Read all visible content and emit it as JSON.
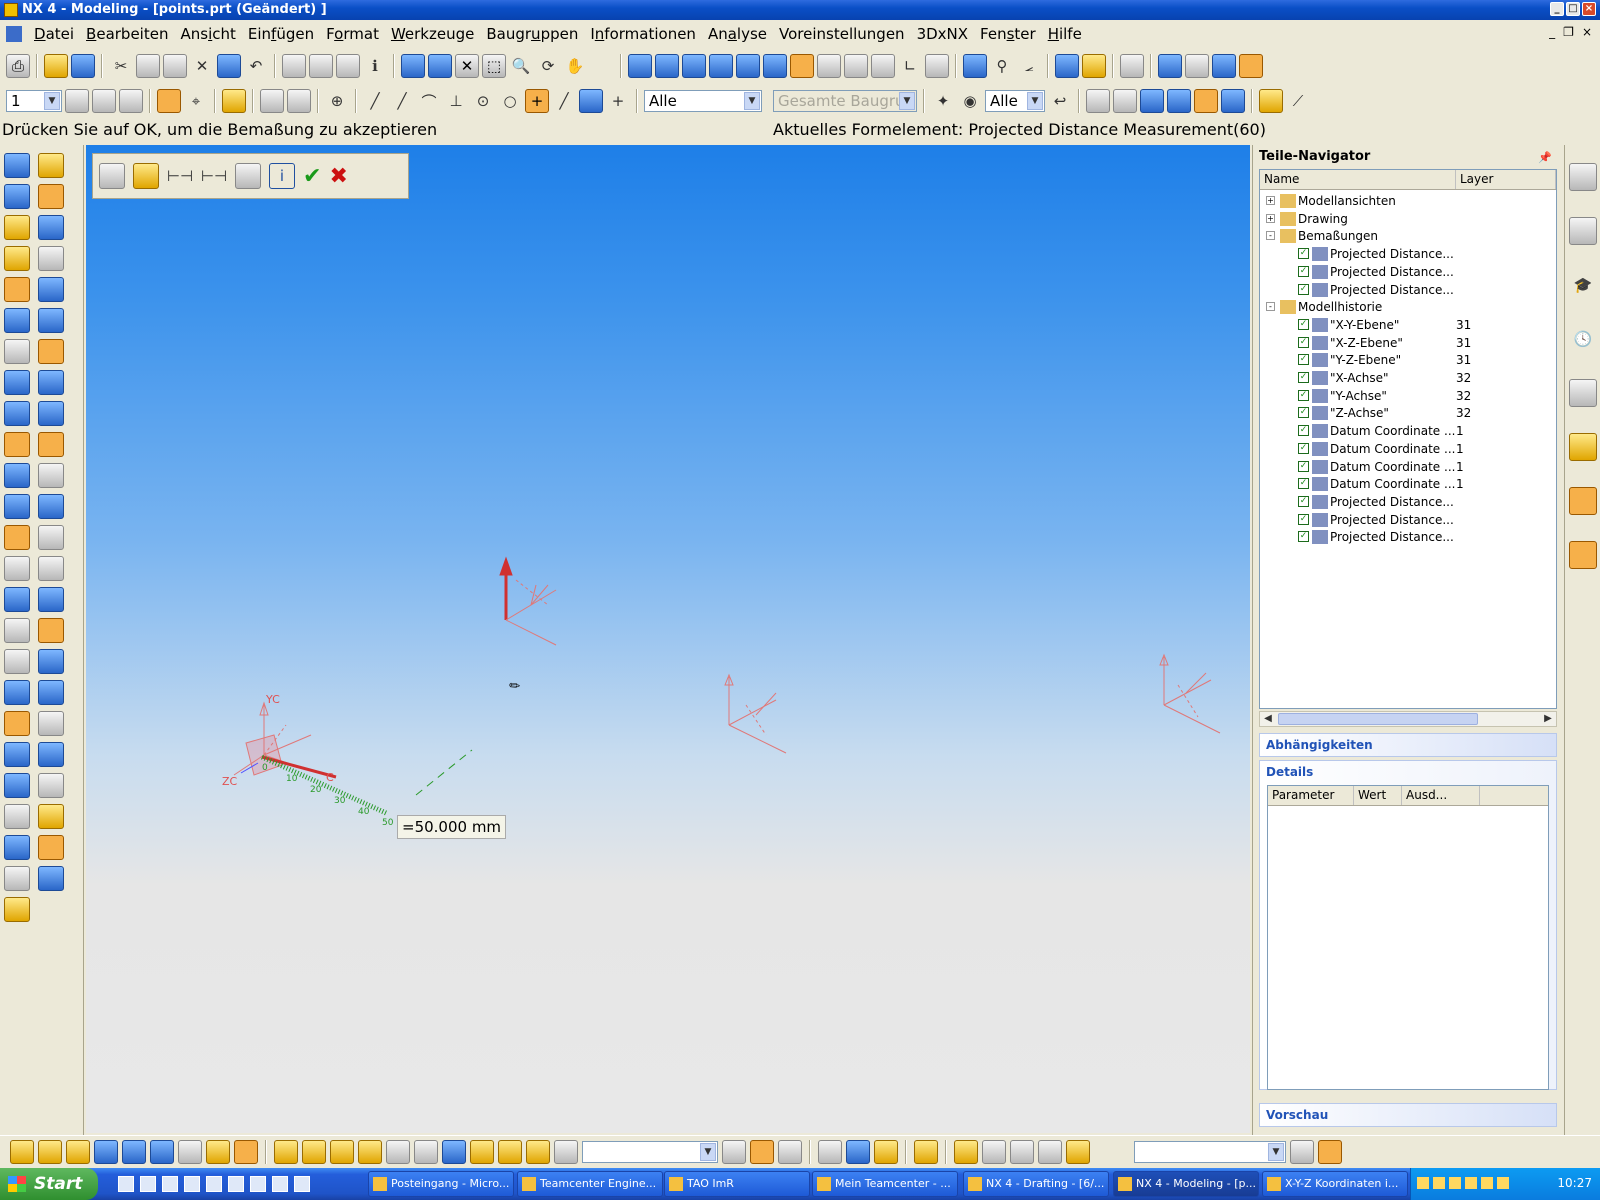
{
  "window": {
    "title": "NX 4 - Modeling - [points.prt (Geändert) ]"
  },
  "menu": [
    {
      "pre": "",
      "u": "D",
      "post": "atei"
    },
    {
      "pre": "",
      "u": "B",
      "post": "earbeiten"
    },
    {
      "pre": "Ans",
      "u": "i",
      "post": "cht"
    },
    {
      "pre": "Ein",
      "u": "f",
      "post": "ügen"
    },
    {
      "pre": "F",
      "u": "o",
      "post": "rmat"
    },
    {
      "pre": "",
      "u": "W",
      "post": "erkzeuge"
    },
    {
      "pre": "Baugr",
      "u": "u",
      "post": "ppen"
    },
    {
      "pre": "I",
      "u": "n",
      "post": "formationen"
    },
    {
      "pre": "An",
      "u": "a",
      "post": "lyse"
    },
    {
      "pre": "Voreinstellungen",
      "u": "",
      "post": ""
    },
    {
      "pre": "3DxNX",
      "u": "",
      "post": ""
    },
    {
      "pre": "Fen",
      "u": "s",
      "post": "ter"
    },
    {
      "pre": "",
      "u": "H",
      "post": "ilfe"
    }
  ],
  "toolbar2": {
    "layer_value": "1",
    "filter1": "Alle",
    "filter2": "Gesamte Baugru",
    "filter3": "Alle"
  },
  "status": {
    "prompt": "Drücken Sie auf OK, um die Bemaßung zu akzeptieren",
    "formel": "Aktuelles Formelement: Projected Distance Measurement(60)"
  },
  "viewport": {
    "dim_value": "=50.000 mm",
    "csys_labels": {
      "yc": "YC",
      "zc": "ZC",
      "xc": "C"
    },
    "ruler_ticks": [
      "0",
      "10",
      "20",
      "30",
      "40",
      "50"
    ]
  },
  "navigator": {
    "title": "Teile-Navigator",
    "col_name": "Name",
    "col_layer": "Layer",
    "rows": [
      {
        "label": "Modellansichten",
        "layer": "",
        "lvl": 0,
        "exp": "+",
        "chk": false
      },
      {
        "label": "Drawing",
        "layer": "",
        "lvl": 0,
        "exp": "+",
        "chk": false
      },
      {
        "label": "Bemaßungen",
        "layer": "",
        "lvl": 0,
        "exp": "-",
        "chk": false
      },
      {
        "label": "Projected Distance...",
        "layer": "",
        "lvl": 1,
        "exp": "",
        "chk": true
      },
      {
        "label": "Projected Distance...",
        "layer": "",
        "lvl": 1,
        "exp": "",
        "chk": true
      },
      {
        "label": "Projected Distance...",
        "layer": "",
        "lvl": 1,
        "exp": "",
        "chk": true
      },
      {
        "label": "Modellhistorie",
        "layer": "",
        "lvl": 0,
        "exp": "-",
        "chk": false
      },
      {
        "label": "\"X-Y-Ebene\"",
        "layer": "31",
        "lvl": 1,
        "exp": "",
        "chk": true
      },
      {
        "label": "\"X-Z-Ebene\"",
        "layer": "31",
        "lvl": 1,
        "exp": "",
        "chk": true
      },
      {
        "label": "\"Y-Z-Ebene\"",
        "layer": "31",
        "lvl": 1,
        "exp": "",
        "chk": true
      },
      {
        "label": "\"X-Achse\"",
        "layer": "32",
        "lvl": 1,
        "exp": "",
        "chk": true
      },
      {
        "label": "\"Y-Achse\"",
        "layer": "32",
        "lvl": 1,
        "exp": "",
        "chk": true
      },
      {
        "label": "\"Z-Achse\"",
        "layer": "32",
        "lvl": 1,
        "exp": "",
        "chk": true
      },
      {
        "label": "Datum Coordinate ...",
        "layer": "1",
        "lvl": 1,
        "exp": "",
        "chk": true
      },
      {
        "label": "Datum Coordinate ...",
        "layer": "1",
        "lvl": 1,
        "exp": "",
        "chk": true
      },
      {
        "label": "Datum Coordinate ...",
        "layer": "1",
        "lvl": 1,
        "exp": "",
        "chk": true
      },
      {
        "label": "Datum Coordinate ...",
        "layer": "1",
        "lvl": 1,
        "exp": "",
        "chk": true
      },
      {
        "label": "Projected Distance...",
        "layer": "",
        "lvl": 1,
        "exp": "",
        "chk": true
      },
      {
        "label": "Projected Distance...",
        "layer": "",
        "lvl": 1,
        "exp": "",
        "chk": true
      },
      {
        "label": "Projected Distance...",
        "layer": "",
        "lvl": 1,
        "exp": "",
        "chk": true
      }
    ],
    "sections": {
      "abh": "Abhängigkeiten",
      "details": "Details",
      "vorschau": "Vorschau"
    },
    "details_cols": [
      "Parameter",
      "Wert",
      "Ausd..."
    ]
  },
  "taskbar": {
    "start": "Start",
    "tasks": [
      "Posteingang - Micro...",
      "Teamcenter Engine...",
      "TAO ImR",
      "Mein Teamcenter - ...",
      "NX 4 - Drafting - [6/...",
      "NX 4 - Modeling - [p...",
      "X-Y-Z Koordinaten i..."
    ],
    "clock": "10:27"
  }
}
